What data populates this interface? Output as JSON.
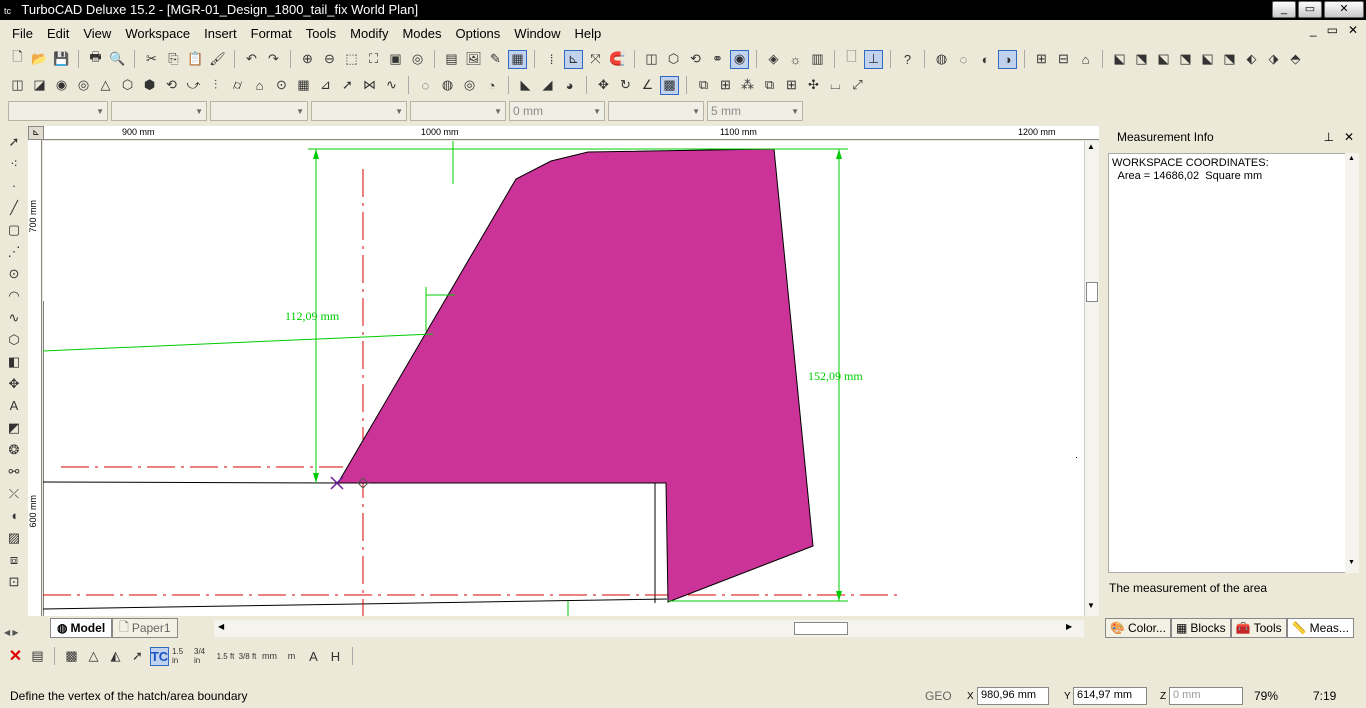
{
  "window": {
    "title": "TurboCAD Deluxe 15.2 - [MGR-01_Design_1800_tail_fix World Plan]",
    "logo": "tc",
    "minimize": "_",
    "restore": "▭",
    "close": "✕"
  },
  "menu": [
    "File",
    "Edit",
    "View",
    "Workspace",
    "Insert",
    "Format",
    "Tools",
    "Modify",
    "Modes",
    "Options",
    "Window",
    "Help"
  ],
  "mdi_controls": [
    "_",
    "▭",
    "✕"
  ],
  "property_bar": {
    "combos": [
      "",
      "",
      "",
      "",
      "",
      "0 mm",
      "",
      "5 mm"
    ]
  },
  "ruler": {
    "top_labels": [
      "900 mm",
      "1000 mm",
      "1100 mm",
      "1200 mm"
    ],
    "left_labels": [
      "700 mm",
      "600 mm"
    ]
  },
  "drawing": {
    "dim_left": "112,09 mm",
    "dim_right": "152,09 mm",
    "fill_color": "#cc3399",
    "dim_color": "#00cc00",
    "center_color": "#dd0000"
  },
  "tabs": {
    "model": "Model",
    "paper": "Paper1"
  },
  "panel": {
    "title": "Measurement Info",
    "pin": "⊥",
    "close": "✕",
    "line1": "WORKSPACE COORDINATES:",
    "line2": "  Area = 14686,02  Square mm",
    "description": "The measurement of the area",
    "tabs": [
      "Color...",
      "Blocks",
      "Tools",
      "Meas..."
    ]
  },
  "snap_bar": [
    "1.5 in",
    "3/4 in",
    "1.5 ft",
    "3/8 ft",
    "mm",
    "m",
    "A",
    "H"
  ],
  "status": {
    "message": "Define the vertex of the hatch/area boundary",
    "geo": "GEO",
    "x_label": "X",
    "x": "980,96 mm",
    "y_label": "Y",
    "y": "614,97 mm",
    "z_label": "Z",
    "z": "0 mm",
    "zoom": "79%",
    "time": "7:19"
  }
}
